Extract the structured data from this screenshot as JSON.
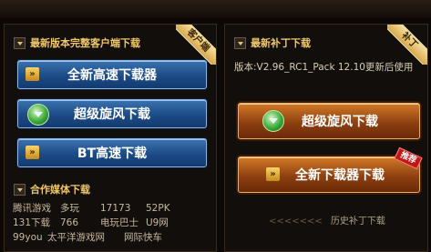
{
  "left": {
    "client_title": "最新版本完整客户端下载",
    "client_ribbon": "客户端",
    "buttons": [
      {
        "label": "全新高速下载器",
        "icon": "chevron-down-icon"
      },
      {
        "label": "超级旋风下载",
        "icon": "whirlwind-icon"
      },
      {
        "label": "BT高速下载",
        "icon": "chevron-down-icon"
      }
    ],
    "media_title": "合作媒体下载",
    "media_rows": [
      [
        "腾讯游戏",
        "多玩",
        "17173",
        "52PK"
      ],
      [
        "131下载",
        "766",
        "电玩巴士",
        "U9网"
      ],
      [
        "99you",
        "太平洋游戏网",
        "网际快车"
      ]
    ]
  },
  "right": {
    "patch_title": "最新补丁下载",
    "patch_ribbon": "补丁",
    "version_text": "版本:V2.96_RC1_Pack  12.10更新后使用",
    "buttons": [
      {
        "label": "超级旋风下载",
        "icon": "whirlwind-icon"
      },
      {
        "label": "全新下载器下载",
        "icon": "chevron-down-icon",
        "badge": "推荐"
      }
    ],
    "history_label": "历史补丁下载",
    "history_decor": "<<<<<<<"
  },
  "colors": {
    "gold": "#f0c86a",
    "blue_button": "#1d4b86",
    "orange_button": "#8e4010"
  }
}
